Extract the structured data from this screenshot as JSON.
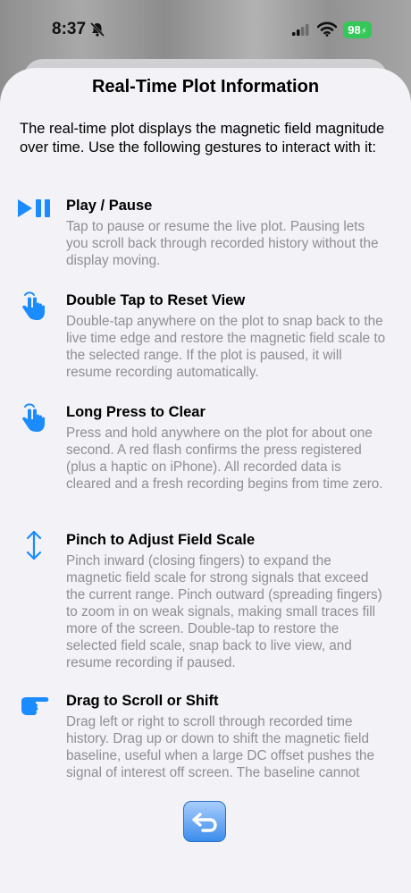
{
  "status": {
    "time": "8:37",
    "battery": "98"
  },
  "sheet": {
    "title": "Real-Time Plot Information",
    "intro": "The real-time plot displays the magnetic field magnitude over time. Use the following gestures to interact with it:"
  },
  "sections": [
    {
      "icon": "play-pause-icon",
      "title": "Play / Pause",
      "body": "Tap to pause or resume the live plot. Pausing lets you scroll back through recorded history without the display moving."
    },
    {
      "icon": "tap-hand-icon",
      "title": "Double Tap to Reset View",
      "body": "Double-tap anywhere on the plot to snap back to the live time edge and restore the magnetic field scale to the selected range. If the plot is paused, it will resume recording automatically."
    },
    {
      "icon": "tap-hand-icon",
      "title": "Long Press to Clear",
      "body": "Press and hold anywhere on the plot for about one second. A red flash confirms the press registered (plus a haptic on iPhone). All recorded data is cleared and a fresh recording begins from time zero."
    },
    {
      "icon": "vertical-arrows-icon",
      "title": "Pinch to Adjust Field Scale",
      "body": "Pinch inward (closing fingers) to expand the magnetic field scale for strong signals that exceed the current range. Pinch outward (spreading fingers) to zoom in on weak signals, making small traces fill more of the screen. Double-tap to restore the selected field scale, snap back to live view, and resume recording if paused."
    },
    {
      "icon": "pointing-hand-icon",
      "title": "Drag to Scroll or Shift",
      "body": "Drag left or right to scroll through recorded time history. Drag up or down to shift the magnetic field baseline, useful when a large DC offset pushes the signal of interest off screen. The baseline cannot"
    }
  ],
  "colors": {
    "accent": "#1a8cff",
    "secondary_text": "#8e8e93",
    "battery": "#34c759"
  },
  "return_icon": "return-arrow-icon"
}
